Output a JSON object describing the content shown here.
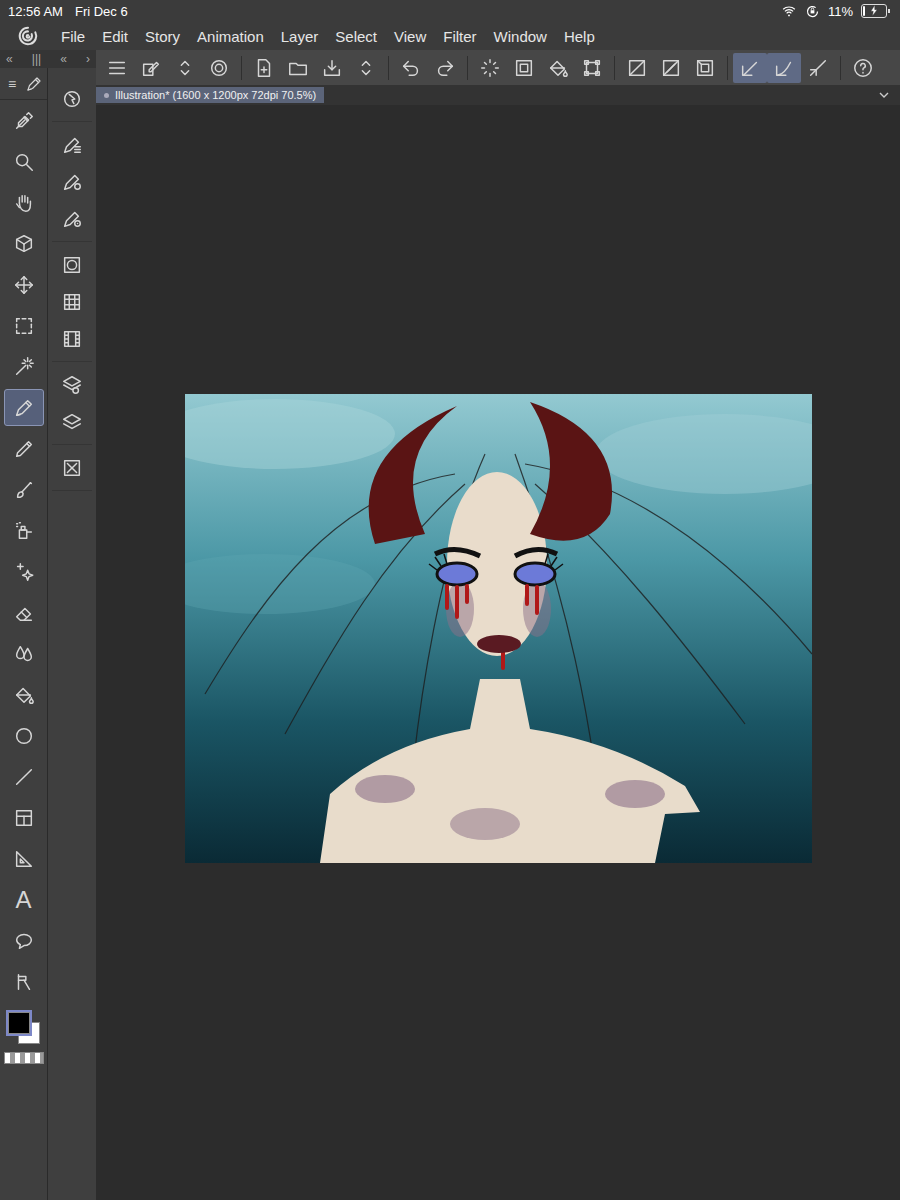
{
  "status_bar": {
    "time": "12:56 AM",
    "date": "Fri Dec 6",
    "battery": "11%",
    "battery_level": 0.11,
    "charging": true
  },
  "menu": [
    "File",
    "Edit",
    "Story",
    "Animation",
    "Layer",
    "Select",
    "View",
    "Filter",
    "Window",
    "Help"
  ],
  "panel_header": [
    "«",
    "|||",
    "«",
    "›"
  ],
  "tool_menu_glyph": "≡",
  "tools": [
    {
      "name": "eyedropper",
      "selected": false
    },
    {
      "name": "zoom",
      "selected": false
    },
    {
      "name": "hand",
      "selected": false
    },
    {
      "name": "object",
      "selected": false
    },
    {
      "name": "move",
      "selected": false
    },
    {
      "name": "selection",
      "selected": false
    },
    {
      "name": "auto-select",
      "selected": false
    },
    {
      "name": "pen",
      "selected": true
    },
    {
      "name": "pencil",
      "selected": false
    },
    {
      "name": "brush",
      "selected": false
    },
    {
      "name": "airbrush",
      "selected": false
    },
    {
      "name": "decoration",
      "selected": false
    },
    {
      "name": "eraser",
      "selected": false
    },
    {
      "name": "blend",
      "selected": false
    },
    {
      "name": "fill",
      "selected": false
    },
    {
      "name": "gradient",
      "selected": false
    },
    {
      "name": "figure",
      "selected": false
    },
    {
      "name": "frame",
      "selected": false
    },
    {
      "name": "ruler",
      "selected": false
    },
    {
      "name": "text",
      "glyph": "A",
      "selected": false
    },
    {
      "name": "balloon",
      "selected": false
    },
    {
      "name": "correct-line",
      "selected": false
    }
  ],
  "colors": {
    "main": "#000000",
    "sub": "#ffffff",
    "main_selected": true
  },
  "panels": [
    [
      "operation"
    ],
    [
      "sub-tool",
      "tool-property",
      "brush-size"
    ],
    [
      "color-wheel",
      "color-set",
      "timeline"
    ],
    [
      "layer-property",
      "layer"
    ],
    [
      "navigator"
    ]
  ],
  "commands": [
    [
      {
        "name": "menu",
        "active": false
      },
      {
        "name": "quick-access",
        "active": false
      },
      {
        "name": "updown",
        "active": false
      },
      {
        "name": "companion",
        "active": false
      }
    ],
    [
      {
        "name": "new",
        "active": false
      },
      {
        "name": "open",
        "active": false
      },
      {
        "name": "save",
        "active": false
      },
      {
        "name": "updown",
        "active": false
      }
    ],
    [
      {
        "name": "undo",
        "active": false
      },
      {
        "name": "redo",
        "active": false
      }
    ],
    [
      {
        "name": "clear",
        "active": false
      },
      {
        "name": "clear-outside",
        "active": false
      },
      {
        "name": "fill",
        "active": false
      },
      {
        "name": "transform",
        "active": false
      }
    ],
    [
      {
        "name": "deselect",
        "active": false
      },
      {
        "name": "invert",
        "active": false
      },
      {
        "name": "selection-border",
        "active": false
      }
    ],
    [
      {
        "name": "snap-ruler",
        "active": true
      },
      {
        "name": "snap-special",
        "active": true
      },
      {
        "name": "snap-grid",
        "active": false
      }
    ],
    [
      {
        "name": "help",
        "active": false
      }
    ]
  ],
  "document_tab": {
    "title": "Illustration* (1600 x 1200px 72dpi 70.5%)",
    "selected": true
  }
}
